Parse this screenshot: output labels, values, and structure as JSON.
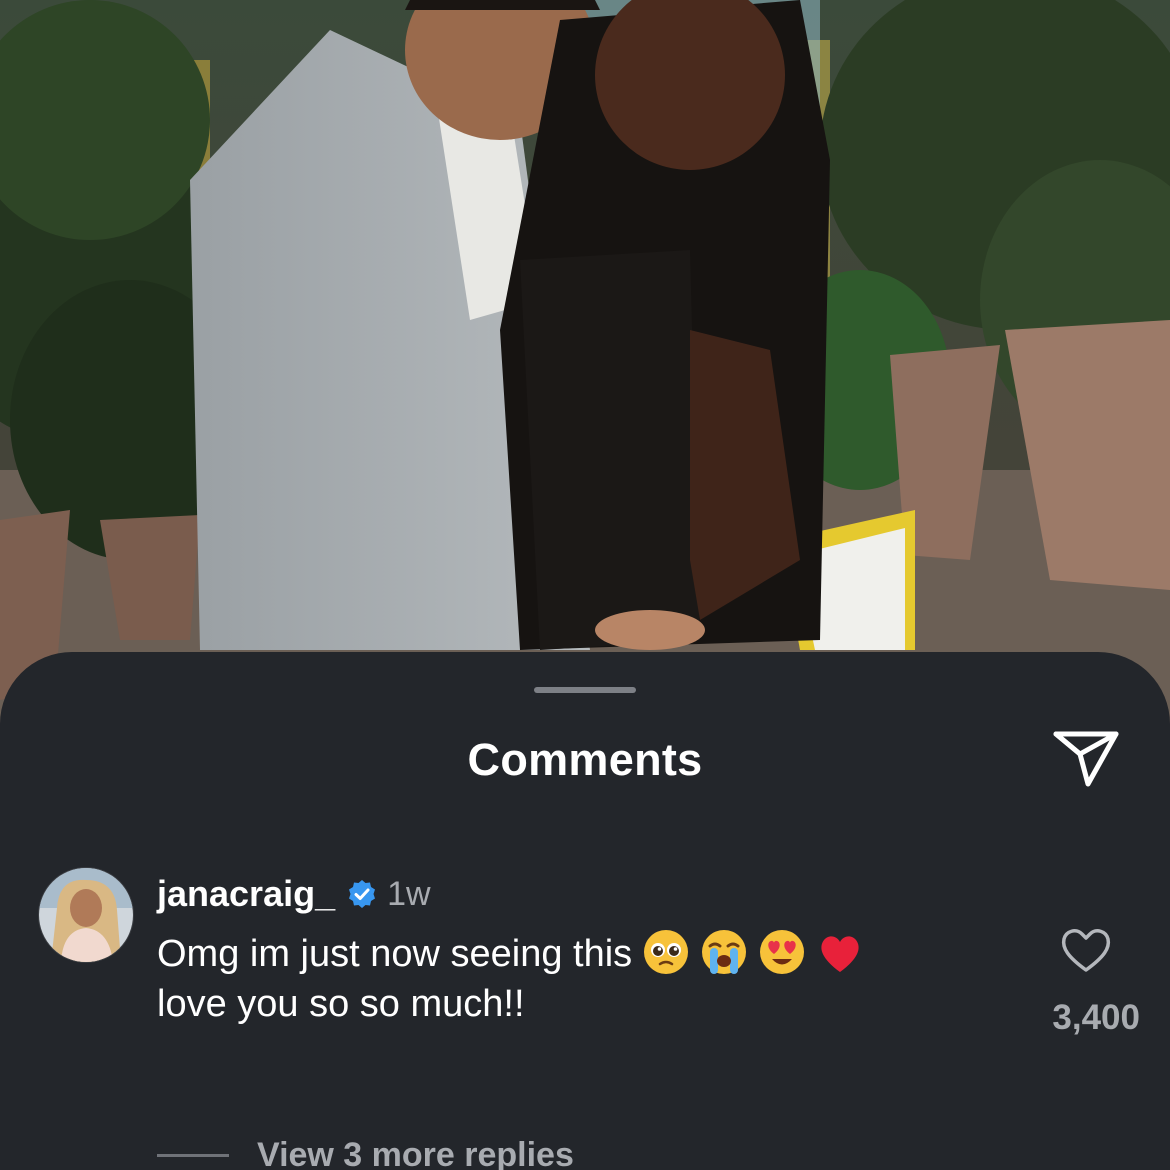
{
  "post": {
    "image_description_icon": "photo-couple-icon"
  },
  "sheet": {
    "title": "Comments",
    "share_icon": "paper-plane-icon"
  },
  "comment": {
    "username": "janacraig_",
    "verified_icon": "verified-badge-icon",
    "time": "1w",
    "text_line1": "Omg im just now seeing this",
    "emojis": [
      "pleading-face-icon",
      "loudly-crying-face-icon",
      "heart-eyes-face-icon",
      "red-heart-icon"
    ],
    "text_line2": "love you so so much!!",
    "like_icon": "heart-outline-icon",
    "like_count": "3,400"
  },
  "replies": {
    "label": "View 3 more replies"
  },
  "colors": {
    "sheet_bg": "#23262b",
    "text_primary": "#ffffff",
    "text_secondary": "#a8abb0",
    "verified_blue": "#3897f0"
  }
}
